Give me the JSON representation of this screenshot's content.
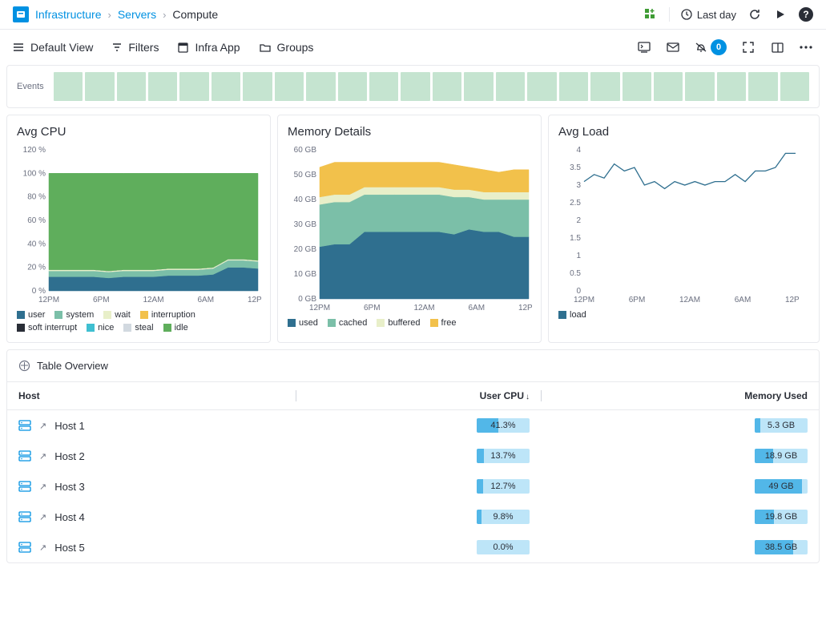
{
  "breadcrumb": {
    "root": "Infrastructure",
    "parent": "Servers",
    "current": "Compute"
  },
  "header": {
    "time_range": "Last day",
    "alerts_count": "0"
  },
  "toolbar": {
    "view": "Default View",
    "filters": "Filters",
    "app": "Infra App",
    "groups": "Groups"
  },
  "events": {
    "label": "Events",
    "cell_count": 24
  },
  "charts": {
    "cpu": {
      "title": "Avg CPU",
      "legend": [
        "user",
        "system",
        "wait",
        "interruption",
        "soft interrupt",
        "nice",
        "steal",
        "idle"
      ]
    },
    "memory": {
      "title": "Memory Details",
      "legend": [
        "used",
        "cached",
        "buffered",
        "free"
      ]
    },
    "load": {
      "title": "Avg Load",
      "legend": [
        "load"
      ]
    }
  },
  "chart_data": [
    {
      "id": "cpu",
      "type": "area",
      "title": "Avg CPU",
      "ylabel": "%",
      "ylim": [
        0,
        120
      ],
      "yticks": [
        0,
        20,
        40,
        60,
        80,
        100,
        120
      ],
      "x": [
        "12PM",
        "6PM",
        "12AM",
        "6AM",
        "12PM"
      ],
      "series": [
        {
          "name": "user",
          "color": "#2f6f8f",
          "values": [
            12,
            12,
            12,
            12,
            11,
            12,
            12,
            12,
            13,
            13,
            13,
            14,
            20,
            20,
            19
          ]
        },
        {
          "name": "system",
          "color": "#7bbfa8",
          "values": [
            5,
            5,
            5,
            5,
            5,
            5,
            5,
            5,
            5,
            5,
            5,
            5,
            6,
            6,
            6
          ]
        },
        {
          "name": "wait",
          "color": "#e8efc9",
          "values": [
            1,
            1,
            1,
            1,
            1,
            1,
            1,
            1,
            1,
            1,
            1,
            1,
            1,
            1,
            1
          ]
        },
        {
          "name": "interruption",
          "color": "#f2c14b",
          "values": [
            0,
            0,
            0,
            0,
            0,
            0,
            0,
            0,
            0,
            0,
            0,
            0,
            0,
            0,
            0
          ]
        },
        {
          "name": "soft interrupt",
          "color": "#2a2e37",
          "values": [
            0,
            0,
            0,
            0,
            0,
            0,
            0,
            0,
            0,
            0,
            0,
            0,
            0,
            0,
            0
          ]
        },
        {
          "name": "nice",
          "color": "#3fbfd1",
          "values": [
            0,
            0,
            0,
            0,
            0,
            0,
            0,
            0,
            0,
            0,
            0,
            0,
            0,
            0,
            0
          ]
        },
        {
          "name": "steal",
          "color": "#d2d9e0",
          "values": [
            0,
            0,
            0,
            0,
            0,
            0,
            0,
            0,
            0,
            0,
            0,
            0,
            0,
            0,
            0
          ]
        },
        {
          "name": "idle",
          "color": "#5fae5c",
          "values": [
            82,
            82,
            82,
            82,
            83,
            82,
            82,
            82,
            81,
            81,
            81,
            80,
            73,
            73,
            74
          ]
        }
      ]
    },
    {
      "id": "memory",
      "type": "area",
      "title": "Memory Details",
      "ylabel": "GB",
      "ylim": [
        0,
        60
      ],
      "yticks": [
        0,
        10,
        20,
        30,
        40,
        50,
        60
      ],
      "x": [
        "12PM",
        "6PM",
        "12AM",
        "6AM",
        "12PM"
      ],
      "series": [
        {
          "name": "used",
          "color": "#2f6f8f",
          "values": [
            21,
            22,
            22,
            27,
            27,
            27,
            27,
            27,
            27,
            26,
            28,
            27,
            27,
            25,
            25
          ]
        },
        {
          "name": "cached",
          "color": "#7bbfa8",
          "values": [
            17,
            17,
            17,
            15,
            15,
            15,
            15,
            15,
            15,
            15,
            13,
            13,
            13,
            15,
            15
          ]
        },
        {
          "name": "buffered",
          "color": "#e8efc9",
          "values": [
            3,
            3,
            3,
            3,
            3,
            3,
            3,
            3,
            3,
            3,
            3,
            3,
            3,
            3,
            3
          ]
        },
        {
          "name": "free",
          "color": "#f2c14b",
          "values": [
            12,
            13,
            13,
            10,
            10,
            10,
            10,
            10,
            10,
            10,
            9,
            9,
            8,
            9,
            9
          ]
        }
      ]
    },
    {
      "id": "load",
      "type": "line",
      "title": "Avg Load",
      "ylabel": "",
      "ylim": [
        0,
        4
      ],
      "yticks": [
        0,
        0.5,
        1,
        1.5,
        2,
        2.5,
        3,
        3.5,
        4
      ],
      "x": [
        "12PM",
        "6PM",
        "12AM",
        "6AM",
        "12PM"
      ],
      "series": [
        {
          "name": "load",
          "color": "#2f6f8f",
          "values": [
            3.1,
            3.3,
            3.2,
            3.6,
            3.4,
            3.5,
            3.0,
            3.1,
            2.9,
            3.1,
            3.0,
            3.1,
            3.0,
            3.1,
            3.1,
            3.3,
            3.1,
            3.4,
            3.4,
            3.5,
            3.9,
            3.9
          ]
        }
      ]
    }
  ],
  "table": {
    "title": "Table Overview",
    "columns": {
      "host": "Host",
      "cpu": "User CPU",
      "mem": "Memory Used"
    },
    "sort_indicator": "↓",
    "rows": [
      {
        "host": "Host 1",
        "cpu_label": "41.3%",
        "cpu_pct": 41.3,
        "mem_label": "5.3 GB",
        "mem_pct": 10
      },
      {
        "host": "Host 2",
        "cpu_label": "13.7%",
        "cpu_pct": 13.7,
        "mem_label": "18.9 GB",
        "mem_pct": 35
      },
      {
        "host": "Host 3",
        "cpu_label": "12.7%",
        "cpu_pct": 12.7,
        "mem_label": "49 GB",
        "mem_pct": 90
      },
      {
        "host": "Host 4",
        "cpu_label": "9.8%",
        "cpu_pct": 9.8,
        "mem_label": "19.8 GB",
        "mem_pct": 37
      },
      {
        "host": "Host 5",
        "cpu_label": "0.0%",
        "cpu_pct": 0.0,
        "mem_label": "38.5 GB",
        "mem_pct": 72
      }
    ]
  },
  "colors": {
    "user": "#2f6f8f",
    "system": "#7bbfa8",
    "wait": "#e8efc9",
    "interruption": "#f2c14b",
    "soft interrupt": "#2a2e37",
    "nice": "#3fbfd1",
    "steal": "#d2d9e0",
    "idle": "#5fae5c",
    "used": "#2f6f8f",
    "cached": "#7bbfa8",
    "buffered": "#e8efc9",
    "free": "#f2c14b",
    "load": "#2f6f8f"
  }
}
